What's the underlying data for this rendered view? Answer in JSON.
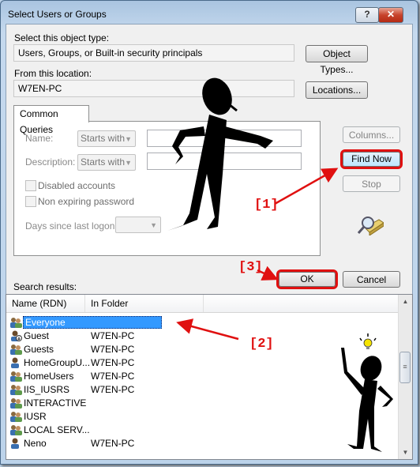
{
  "window": {
    "title": "Select Users or Groups",
    "help_label": "?",
    "close_label": "✕"
  },
  "object_type": {
    "label": "Select this object type:",
    "value": "Users, Groups, or Built-in security principals",
    "button": "Object Types..."
  },
  "location": {
    "label": "From this location:",
    "value": "W7EN-PC",
    "button": "Locations..."
  },
  "common_queries": {
    "tab_label": "Common Queries",
    "name_label": "Name:",
    "name_mode": "Starts with",
    "name_value": "",
    "description_label": "Description:",
    "description_mode": "Starts with",
    "description_value": "",
    "disabled_accounts_label": "Disabled accounts",
    "non_expiring_label": "Non expiring password",
    "days_label": "Days since last logon:",
    "days_value": ""
  },
  "side_buttons": {
    "columns": "Columns...",
    "find_now": "Find Now",
    "stop": "Stop"
  },
  "dialog_buttons": {
    "ok": "OK",
    "cancel": "Cancel"
  },
  "results": {
    "label": "Search results:",
    "columns": [
      "Name (RDN)",
      "In Folder"
    ],
    "rows": [
      {
        "name": "Everyone",
        "folder": "",
        "icon": "group-icon",
        "selected": true
      },
      {
        "name": "Guest",
        "folder": "W7EN-PC",
        "icon": "user-disabled-icon"
      },
      {
        "name": "Guests",
        "folder": "W7EN-PC",
        "icon": "group-icon"
      },
      {
        "name": "HomeGroupU...",
        "folder": "W7EN-PC",
        "icon": "user-icon"
      },
      {
        "name": "HomeUsers",
        "folder": "W7EN-PC",
        "icon": "group-icon"
      },
      {
        "name": "IIS_IUSRS",
        "folder": "W7EN-PC",
        "icon": "group-icon"
      },
      {
        "name": "INTERACTIVE",
        "folder": "",
        "icon": "group-icon"
      },
      {
        "name": "IUSR",
        "folder": "",
        "icon": "group-icon"
      },
      {
        "name": "LOCAL SERV...",
        "folder": "",
        "icon": "group-icon"
      },
      {
        "name": "Neno",
        "folder": "W7EN-PC",
        "icon": "user-icon"
      }
    ]
  },
  "annotations": {
    "step1": "[1]",
    "step2": "[2]",
    "step3": "[3]",
    "color": "#e01010"
  }
}
